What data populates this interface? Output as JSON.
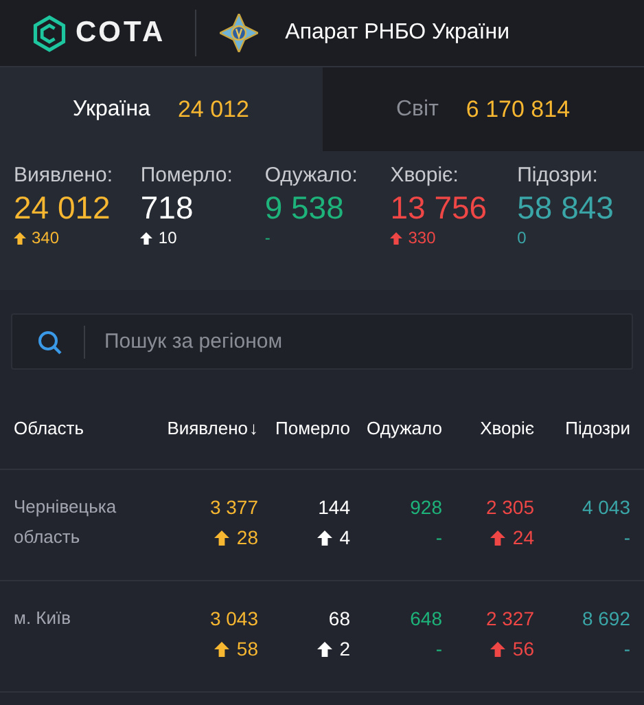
{
  "header": {
    "logo_text": "СОТА",
    "org_title": "Апарат РНБО України"
  },
  "tabs": [
    {
      "label": "Україна",
      "value": "24 012",
      "selected": true
    },
    {
      "label": "Світ",
      "value": "6 170 814",
      "selected": false
    }
  ],
  "stats": [
    {
      "label": "Виявлено:",
      "value": "24 012",
      "color": "#f7b731",
      "delta": {
        "kind": "increase",
        "text": "340"
      }
    },
    {
      "label": "Померло:",
      "value": "718",
      "color": "#ffffff",
      "delta": {
        "kind": "increase",
        "text": "10"
      }
    },
    {
      "label": "Одужало:",
      "value": "9 538",
      "color": "#1db37a",
      "delta": {
        "kind": "plain",
        "text": "-"
      }
    },
    {
      "label": "Хворіє:",
      "value": "13 756",
      "color": "#ef4646",
      "delta": {
        "kind": "increase",
        "text": "330"
      }
    },
    {
      "label": "Підозри:",
      "value": "58 843",
      "color": "#3aa6a8",
      "delta": {
        "kind": "plain",
        "text": "0"
      }
    }
  ],
  "search": {
    "placeholder": "Пошук за регіоном"
  },
  "table": {
    "columns": [
      {
        "label": "Область",
        "kind": "region"
      },
      {
        "label": "Виявлено",
        "sort_mark": "↓",
        "kind": "confirmed"
      },
      {
        "label": "Померло",
        "kind": "deaths"
      },
      {
        "label": "Одужало",
        "kind": "recovered"
      },
      {
        "label": "Хворіє",
        "kind": "sick"
      },
      {
        "label": "Підозри",
        "kind": "suspected"
      }
    ],
    "rows": [
      {
        "cells": [
          {
            "value": "Чернівецька область"
          },
          {
            "value": "3 377",
            "delta": {
              "kind": "increase",
              "text": "28"
            }
          },
          {
            "value": "144",
            "delta": {
              "kind": "increase",
              "text": "4"
            }
          },
          {
            "value": "928",
            "delta": {
              "kind": "plain",
              "text": "-"
            }
          },
          {
            "value": "2 305",
            "delta": {
              "kind": "increase",
              "text": "24"
            }
          },
          {
            "value": "4 043",
            "delta": {
              "kind": "plain",
              "text": "-"
            }
          }
        ]
      },
      {
        "cells": [
          {
            "value": "м. Київ"
          },
          {
            "value": "3 043",
            "delta": {
              "kind": "increase",
              "text": "58"
            }
          },
          {
            "value": "68",
            "delta": {
              "kind": "increase",
              "text": "2"
            }
          },
          {
            "value": "648",
            "delta": {
              "kind": "plain",
              "text": "-"
            }
          },
          {
            "value": "2 327",
            "delta": {
              "kind": "increase",
              "text": "56"
            }
          },
          {
            "value": "8 692",
            "delta": {
              "kind": "plain",
              "text": "-"
            }
          }
        ]
      }
    ]
  }
}
